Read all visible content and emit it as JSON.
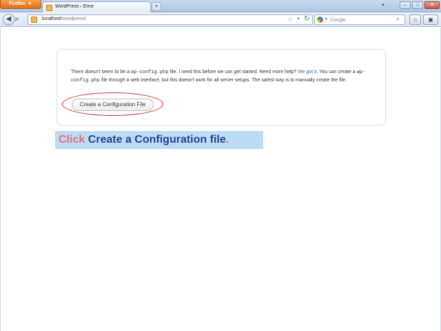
{
  "browser": {
    "menu_button": "Firefox",
    "tab_title": "WordPress › Error",
    "new_tab_label": "+",
    "window_buttons": {
      "minimize": "–",
      "maximize": "□",
      "close": "✕"
    }
  },
  "navbar": {
    "url_host": "localhost",
    "url_path": "/wordpress/",
    "search_placeholder": "Google",
    "search_engine_icon": "google-icon"
  },
  "page": {
    "message_part1": "There doesn't seem to be a ",
    "message_code1": "wp-config.php",
    "message_part2": " file. I need this before we can get started. Need more help? ",
    "message_link": "We got it",
    "message_part3": ". You can create a ",
    "message_code2": "wp-config.php",
    "message_part4": " file through a web interface, but this doesn't work for all server setups. The safest way is to manually create the file.",
    "config_button_label": "Create a Configuration File"
  },
  "instruction": {
    "verb": "Click",
    "target": "Create a Configuration file",
    "end": "."
  },
  "colors": {
    "highlight": "#d4232c",
    "instruction_bg": "#bcdcf4",
    "instruction_verb": "#ec6a7a",
    "instruction_target": "#2a3f9b",
    "link": "#21759b"
  }
}
